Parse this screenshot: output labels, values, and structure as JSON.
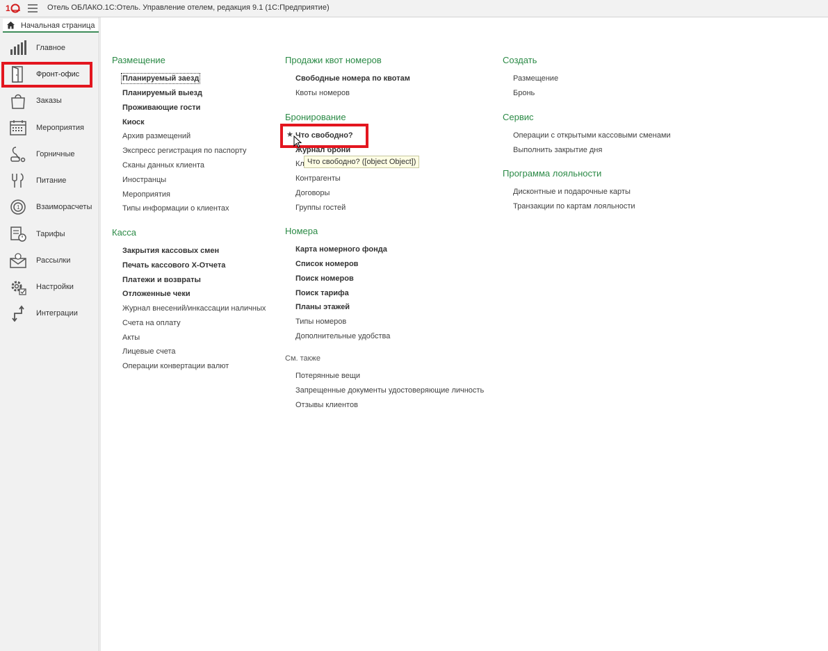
{
  "titlebar": {
    "title": "Отель ОБЛАКО.1С:Отель. Управление отелем, редакция 9.1  (1С:Предприятие)"
  },
  "sidebar": {
    "home_label": "Начальная страница",
    "items": [
      {
        "label": "Главное",
        "icon": "bar-chart-icon"
      },
      {
        "label": "Фронт-офис",
        "icon": "door-icon"
      },
      {
        "label": "Заказы",
        "icon": "shopping-bag-icon"
      },
      {
        "label": "Мероприятия",
        "icon": "calendar-icon"
      },
      {
        "label": "Горничные",
        "icon": "vacuum-icon"
      },
      {
        "label": "Питание",
        "icon": "dining-icon"
      },
      {
        "label": "Взаиморасчеты",
        "icon": "settlement-icon"
      },
      {
        "label": "Тарифы",
        "icon": "tariff-icon"
      },
      {
        "label": "Рассылки",
        "icon": "mail-icon"
      },
      {
        "label": "Настройки",
        "icon": "gear-icon"
      },
      {
        "label": "Интеграции",
        "icon": "integration-icon"
      }
    ],
    "active_index": 1
  },
  "main": {
    "placement": {
      "title": "Размещение",
      "links": [
        "Планируемый заезд",
        "Планируемый выезд",
        "Проживающие гости",
        "Киоск",
        "Архив размещений",
        "Экспресс регистрация по паспорту",
        "Сканы данных клиента",
        "Иностранцы",
        "Мероприятия",
        "Типы информации о клиентах"
      ]
    },
    "cash": {
      "title": "Касса",
      "links": [
        "Закрытия кассовых смен",
        "Печать кассового Х-Отчета",
        "Платежи и возвраты",
        "Отложенные чеки",
        "Журнал внесений/инкассации наличных",
        "Счета на оплату",
        "Акты",
        "Лицевые счета",
        "Операции конвертации валют"
      ]
    },
    "quota_sales": {
      "title": "Продажи квот номеров",
      "links": [
        "Свободные номера по квотам",
        "Квоты номеров"
      ]
    },
    "booking": {
      "title": "Бронирование",
      "links": [
        "Что свободно?",
        "Журнал брони",
        "Кл",
        "Контрагенты",
        "Договоры",
        "Группы гостей"
      ]
    },
    "rooms": {
      "title": "Номера",
      "links": [
        "Карта номерного фонда",
        "Список номеров",
        "Поиск номеров",
        "Поиск тарифа",
        "Планы этажей",
        "Типы номеров",
        "Дополнительные удобства"
      ]
    },
    "see_also": {
      "title": "См. также",
      "links": [
        "Потерянные вещи",
        "Запрещенные документы удостоверяющие личность",
        "Отзывы клиентов"
      ]
    },
    "create": {
      "title": "Создать",
      "links": [
        "Размещение",
        "Бронь"
      ]
    },
    "service": {
      "title": "Сервис",
      "links": [
        "Операции с открытыми кассовыми сменами",
        "Выполнить закрытие дня"
      ]
    },
    "loyalty": {
      "title": "Программа лояльности",
      "links": [
        "Дисконтные и подарочные карты",
        "Транзакции по картам лояльности"
      ]
    },
    "tooltip": "Что свободно? ([object Object])",
    "favorite_star": "★"
  },
  "colors": {
    "section_title": "#2b8a46",
    "highlight": "#e3161f",
    "sidebar_bg": "#f1f1f1",
    "tooltip_bg": "#fdfde4"
  }
}
